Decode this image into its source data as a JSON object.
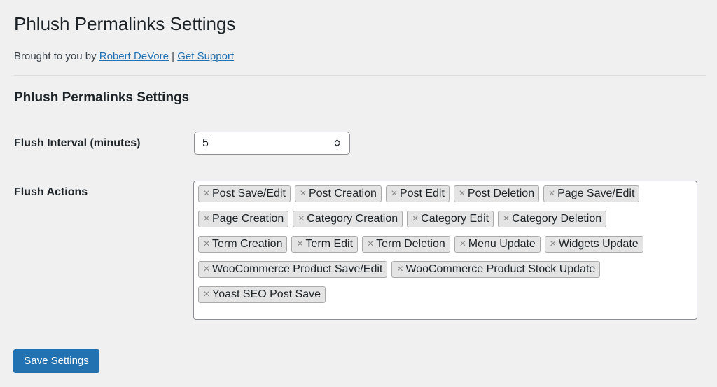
{
  "header": {
    "title": "Phlush Permalinks Settings",
    "byline_prefix": "Brought to you by ",
    "author_link": "Robert DeVore",
    "separator": " | ",
    "support_link": "Get Support"
  },
  "section": {
    "title": "Phlush Permalinks Settings"
  },
  "fields": {
    "interval_label": "Flush Interval (minutes)",
    "interval_value": "5",
    "actions_label": "Flush Actions",
    "remove_symbol": "×",
    "actions": [
      "Post Save/Edit",
      "Post Creation",
      "Post Edit",
      "Post Deletion",
      "Page Save/Edit",
      "Page Creation",
      "Category Creation",
      "Category Edit",
      "Category Deletion",
      "Term Creation",
      "Term Edit",
      "Term Deletion",
      "Menu Update",
      "Widgets Update",
      "WooCommerce Product Save/Edit",
      "WooCommerce Product Stock Update",
      "Yoast SEO Post Save"
    ]
  },
  "footer": {
    "save_label": "Save Settings"
  },
  "colors": {
    "background": "#f0f0f1",
    "link": "#2271b1",
    "primary_button": "#2271b1",
    "tag_background": "#e4e4e4",
    "tag_border": "#aaaaaa"
  }
}
